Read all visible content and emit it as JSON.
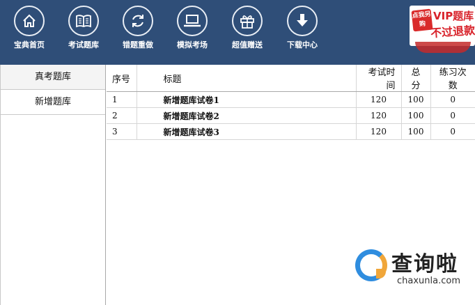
{
  "toolbar": {
    "items": [
      {
        "label": "宝典首页",
        "icon": "home-icon"
      },
      {
        "label": "考试题库",
        "icon": "book-icon"
      },
      {
        "label": "错题重做",
        "icon": "refresh-icon"
      },
      {
        "label": "模拟考场",
        "icon": "laptop-icon"
      },
      {
        "label": "超值赠送",
        "icon": "gift-icon"
      },
      {
        "label": "下载中心",
        "icon": "download-icon"
      }
    ],
    "bg_color": "#2f4e78"
  },
  "vip_banner": {
    "badge": "点我另购",
    "title": "VIP题库",
    "subtitle": "不过退款"
  },
  "sidebar": {
    "items": [
      {
        "label": "真考题库"
      },
      {
        "label": "新增题库"
      }
    ]
  },
  "table": {
    "headers": {
      "index": "序号",
      "title": "标题",
      "time": "考试时间",
      "score": "总分",
      "practice": "练习次数"
    },
    "rows": [
      {
        "index": "1",
        "title": "新增题库试卷1",
        "time": "120",
        "score": "100",
        "practice": "0"
      },
      {
        "index": "2",
        "title": "新增题库试卷2",
        "time": "120",
        "score": "100",
        "practice": "0"
      },
      {
        "index": "3",
        "title": "新增题库试卷3",
        "time": "120",
        "score": "100",
        "practice": "0"
      }
    ]
  },
  "watermark": {
    "cn": "查询啦",
    "en": "chaxunla.com"
  }
}
